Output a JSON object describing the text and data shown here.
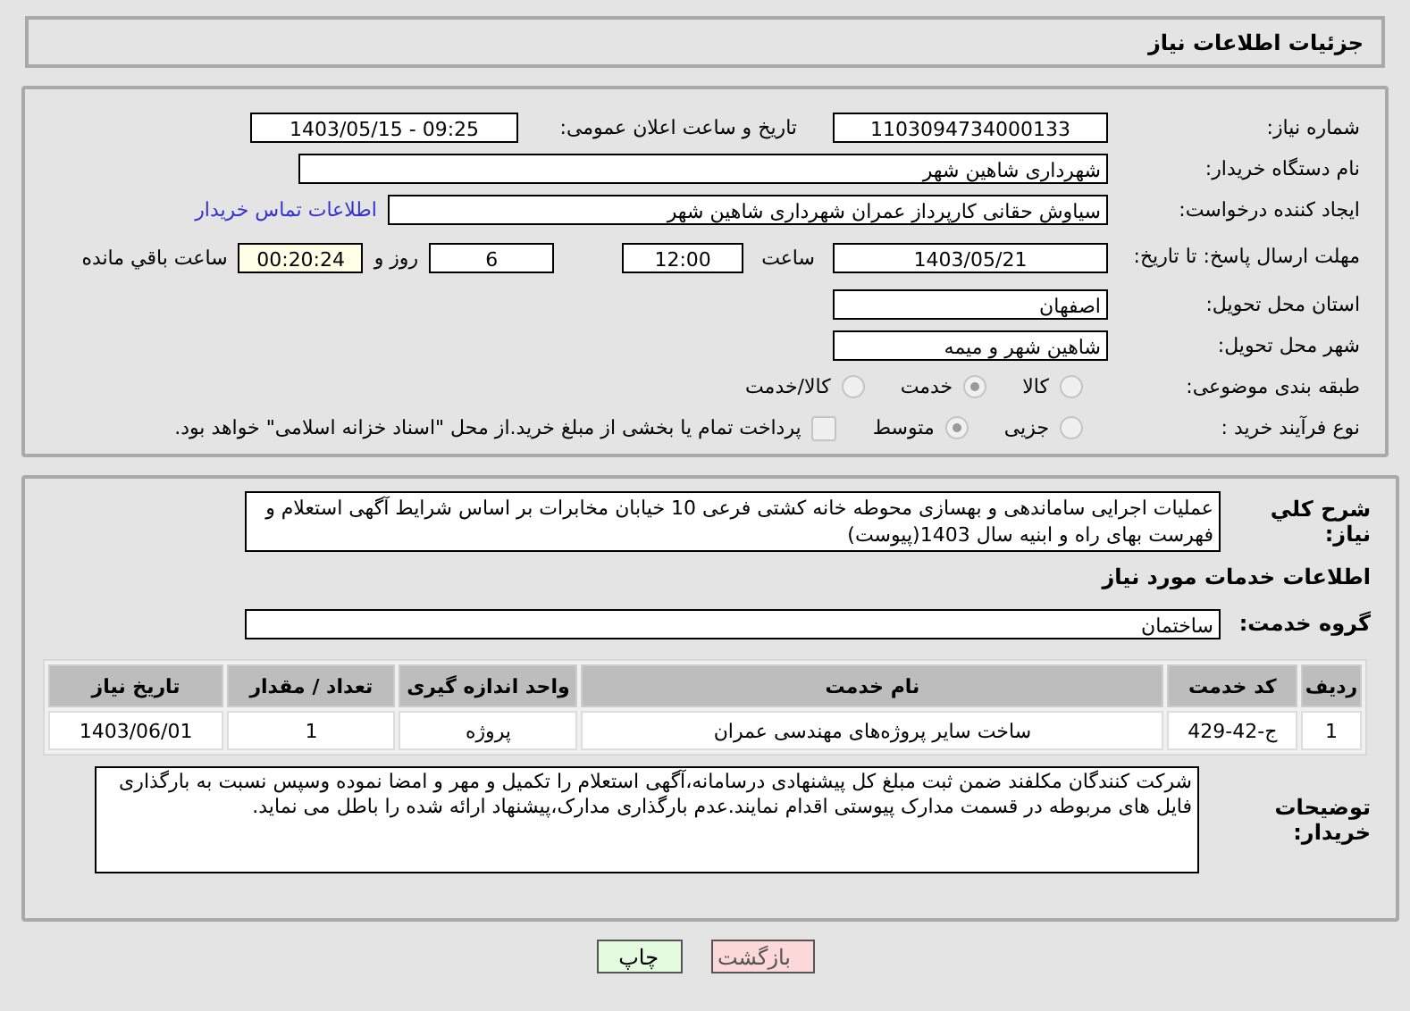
{
  "header": {
    "title": "جزئیات اطلاعات نیاز"
  },
  "details": {
    "need_number": {
      "label": "شماره نیاز:",
      "value": "1103094734000133"
    },
    "announce": {
      "label": "تاریخ و ساعت اعلان عمومی:",
      "value": "1403/05/15 - 09:25"
    },
    "buyer": {
      "label": "نام دستگاه خریدار:",
      "value": "شهرداری شاهین شهر"
    },
    "creator": {
      "label": "ایجاد کننده درخواست:",
      "value": "سیاوش حقانی کارپرداز عمران شهرداری شاهین شهر",
      "link": "اطلاعات تماس خریدار"
    },
    "deadline": {
      "label": "مهلت ارسال پاسخ: تا تاریخ:",
      "date": "1403/05/21",
      "time_label": "ساعت",
      "time": "12:00",
      "days": "6",
      "days_label": "روز و",
      "remaining": "00:20:24",
      "remaining_label": "ساعت باقي مانده"
    },
    "province": {
      "label": "استان محل تحویل:",
      "value": "اصفهان"
    },
    "city": {
      "label": "شهر محل تحویل:",
      "value": "شاهین شهر و میمه"
    },
    "category": {
      "label": "طبقه بندی موضوعی:",
      "options": [
        {
          "label": "کالا",
          "selected": false
        },
        {
          "label": "خدمت",
          "selected": true
        },
        {
          "label": "کالا/خدمت",
          "selected": false
        }
      ]
    },
    "process": {
      "label": "نوع فرآیند خرید :",
      "options": [
        {
          "label": "جزیی",
          "selected": false
        },
        {
          "label": "متوسط",
          "selected": true
        }
      ],
      "payment": {
        "checked": false,
        "text": "پرداخت تمام یا بخشی از مبلغ خرید.از محل \"اسناد خزانه اسلامی\" خواهد بود."
      }
    }
  },
  "services": {
    "summary": {
      "label": "شرح کلي نياز:",
      "value": "عملیات اجرایی ساماندهی و بهسازی محوطه خانه کشتی فرعی 10 خیابان مخابرات بر اساس شرایط آگهی استعلام و فهرست بهای راه و ابنیه سال 1403(پیوست)"
    },
    "heading": "اطلاعات خدمات مورد نیاز",
    "group": {
      "label": "گروه خدمت:",
      "value": "ساختمان"
    },
    "table": {
      "columns": [
        "ردیف",
        "کد خدمت",
        "نام خدمت",
        "واحد اندازه گیری",
        "تعداد / مقدار",
        "تاریخ نیاز"
      ],
      "rows": [
        [
          "1",
          "ج-42-429",
          "ساخت سایر پروژه‌های مهندسی عمران",
          "پروژه",
          "1",
          "1403/06/01"
        ]
      ]
    },
    "notes": {
      "label": "توضیحات خریدار:",
      "value": "شرکت کنندگان مکلفند ضمن ثبت مبلغ کل پیشنهادی درسامانه،آگهی استعلام را  تکمیل و مهر و امضا نموده وسپس نسبت به بارگذاری فایل های مربوطه در قسمت مدارک پیوستی اقدام نمایند.عدم بارگذاری مدارک،پیشنهاد ارائه شده را باطل می نماید."
    }
  },
  "buttons": [
    {
      "kind": "back",
      "label": "بازگشت"
    },
    {
      "kind": "print",
      "label": "چاپ"
    }
  ]
}
